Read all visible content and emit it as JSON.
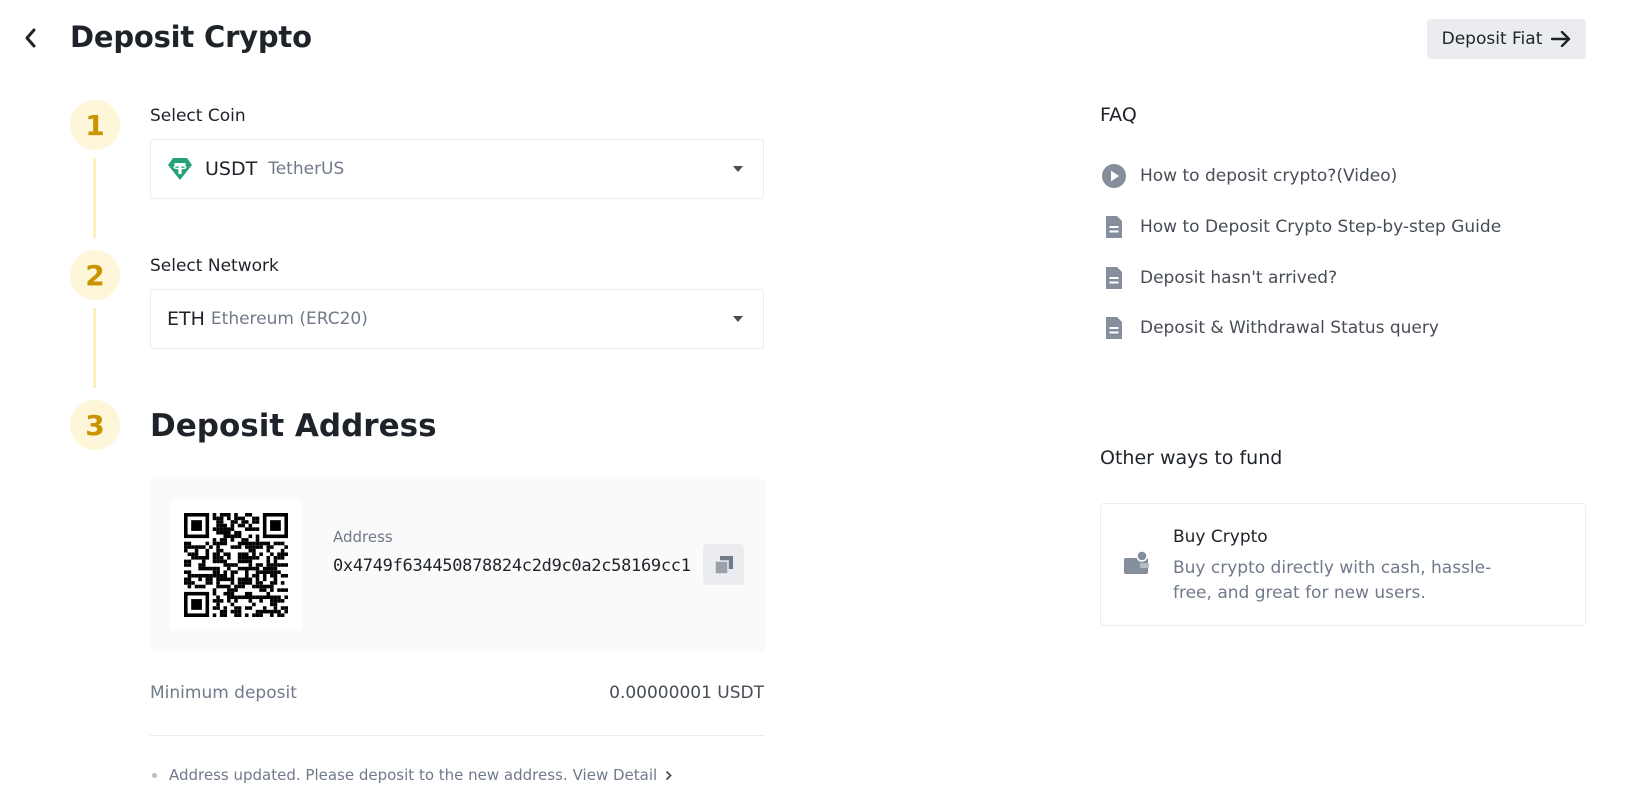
{
  "header": {
    "title": "Deposit Crypto",
    "deposit_fiat_label": "Deposit Fiat"
  },
  "steps": [
    {
      "number": "1",
      "label": "Select Coin"
    },
    {
      "number": "2",
      "label": "Select Network"
    },
    {
      "number": "3",
      "label": "Deposit Address"
    }
  ],
  "coin_select": {
    "symbol": "USDT",
    "name": "TetherUS",
    "icon": "tether-icon",
    "icon_color": "#26a17b"
  },
  "network_select": {
    "symbol": "ETH",
    "name": "Ethereum (ERC20)"
  },
  "deposit": {
    "address_label": "Address",
    "address": "0x4749f634450878824c2d9c0a2c58169cc1",
    "min_deposit_label": "Minimum deposit",
    "min_deposit_value": "0.00000001 USDT",
    "notice_text": "Address updated. Please deposit to the new address.",
    "notice_link": "View Detail"
  },
  "faq": {
    "title": "FAQ",
    "items": [
      {
        "label": "How to deposit crypto?(Video)",
        "icon": "play-icon"
      },
      {
        "label": "How to Deposit Crypto Step-by-step Guide",
        "icon": "document-icon"
      },
      {
        "label": "Deposit hasn't arrived?",
        "icon": "document-icon"
      },
      {
        "label": "Deposit & Withdrawal Status query",
        "icon": "document-icon"
      }
    ]
  },
  "other_ways": {
    "title": "Other ways to fund",
    "card_title": "Buy Crypto",
    "card_desc": "Buy crypto directly with cash, hassle-free, and great for new users."
  },
  "colors": {
    "accent": "#c99400",
    "step_bg": "#fef6d8",
    "text": "#1e2329",
    "muted": "#707a8a"
  }
}
